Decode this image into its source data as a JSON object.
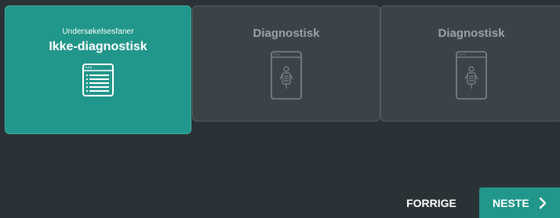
{
  "cards": [
    {
      "subtitle": "Undersøkelsesfaner",
      "title": "Ikke-diagnostisk",
      "icon": "list-window-icon",
      "selected": true
    },
    {
      "title": "Diagnostisk",
      "icon": "xray-window-icon",
      "selected": false
    },
    {
      "title": "Diagnostisk",
      "icon": "xray-window-icon",
      "selected": false
    }
  ],
  "nav": {
    "prev_label": "FORRIGE",
    "next_label": "NESTE",
    "next_icon": "chevron-right-icon"
  },
  "colors": {
    "background": "#2b3236",
    "accent": "#21968a",
    "card_unselected": "#3c4347",
    "muted_text": "#9aa1a5"
  }
}
